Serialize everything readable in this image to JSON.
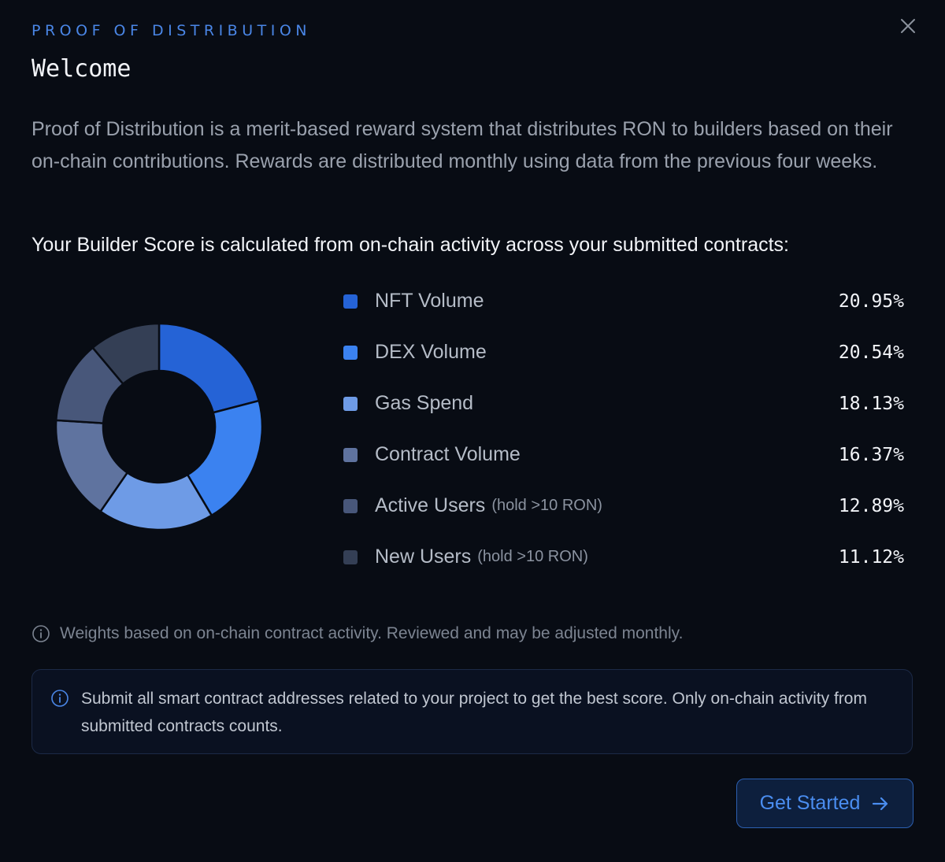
{
  "header": {
    "eyebrow": "PROOF OF DISTRIBUTION",
    "title": "Welcome",
    "close_icon": "close-icon"
  },
  "intro": "Proof of Distribution is a merit-based reward system that distributes RON to builders based on their on-chain contributions. Rewards are distributed monthly using data from the previous four weeks.",
  "score_heading": "Your Builder Score is calculated from on-chain activity across your submitted contracts:",
  "chart_data": {
    "type": "pie",
    "donut": true,
    "categories": [
      "NFT Volume",
      "DEX Volume",
      "Gas Spend",
      "Contract Volume",
      "Active Users",
      "New Users"
    ],
    "values": [
      20.95,
      20.54,
      18.13,
      16.37,
      12.89,
      11.12
    ],
    "colors": [
      "#2563d6",
      "#3b82f0",
      "#6e9be6",
      "#5f739f",
      "#48577a",
      "#343f55"
    ],
    "unit": "%"
  },
  "legend": [
    {
      "label": "NFT Volume",
      "sub": "",
      "value": "20.95%",
      "color": "#2563d6"
    },
    {
      "label": "DEX Volume",
      "sub": "",
      "value": "20.54%",
      "color": "#3b82f0"
    },
    {
      "label": "Gas Spend",
      "sub": "",
      "value": "18.13%",
      "color": "#6e9be6"
    },
    {
      "label": "Contract Volume",
      "sub": "",
      "value": "16.37%",
      "color": "#5f739f"
    },
    {
      "label": "Active Users",
      "sub": "(hold >10 RON)",
      "value": "12.89%",
      "color": "#48577a"
    },
    {
      "label": "New Users",
      "sub": "(hold >10 RON)",
      "value": "11.12%",
      "color": "#343f55"
    }
  ],
  "note": {
    "icon": "info-icon",
    "text": "Weights based on on-chain contract activity. Reviewed and may be adjusted monthly."
  },
  "callout": {
    "icon": "info-icon",
    "text": "Submit all smart contract addresses related to your project to get the best score. Only on-chain activity from submitted contracts counts."
  },
  "cta": {
    "label": "Get Started",
    "icon": "arrow-right-icon"
  },
  "colors": {
    "accent": "#4a86e6",
    "background": "#080c14"
  }
}
